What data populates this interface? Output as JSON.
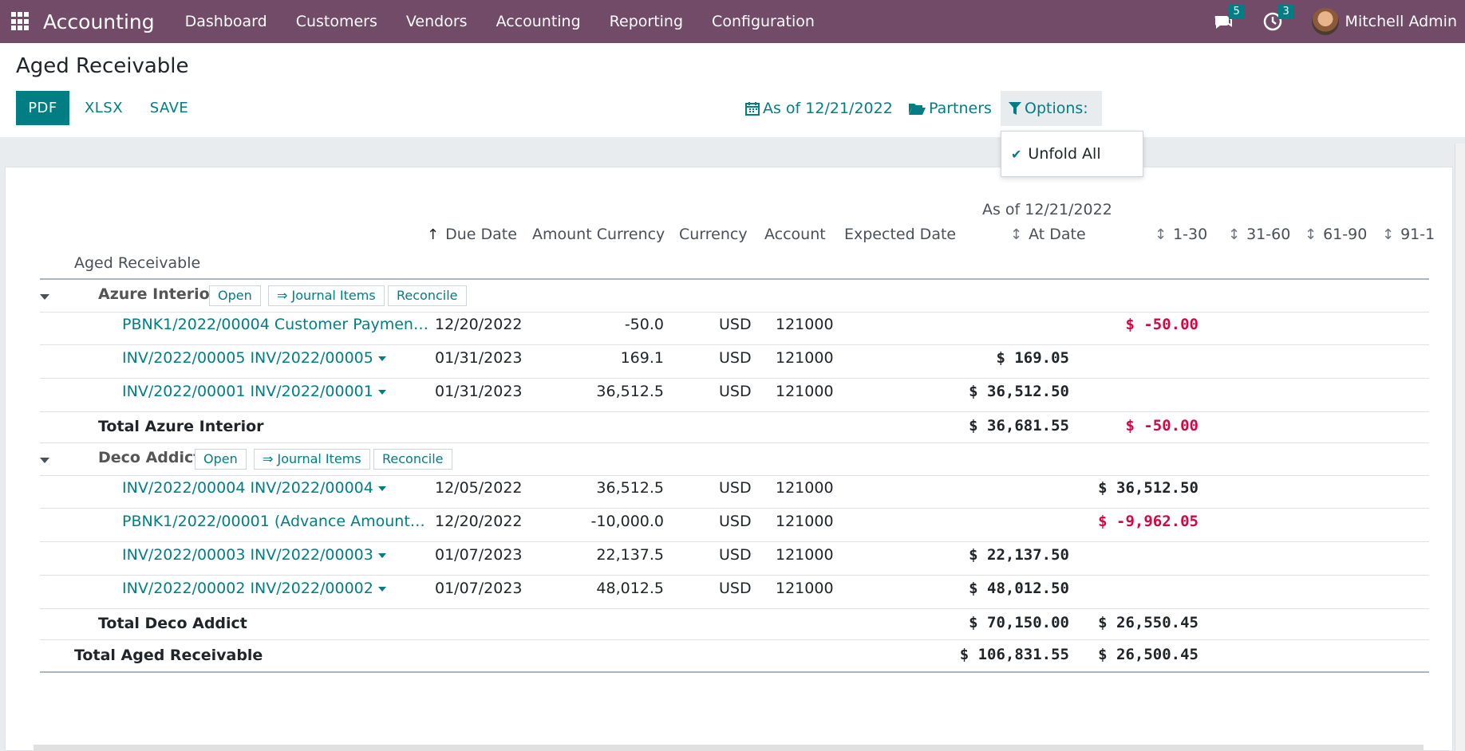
{
  "navbar": {
    "brand": "Accounting",
    "menu": [
      "Dashboard",
      "Customers",
      "Vendors",
      "Accounting",
      "Reporting",
      "Configuration"
    ],
    "messages_count": "5",
    "activities_count": "3",
    "user_name": "Mitchell Admin"
  },
  "control": {
    "title": "Aged Receivable",
    "pdf_label": "PDF",
    "xlsx_label": "XLSX",
    "save_label": "SAVE",
    "date_filter": "As of 12/21/2022",
    "partners_filter": "Partners",
    "options_filter": "Options:",
    "dropdown_item": "Unfold All"
  },
  "report": {
    "as_of": "As of 12/21/2022",
    "columns": {
      "name": "Aged Receivable",
      "due_date": "Due Date",
      "amount_currency": "Amount Currency",
      "currency": "Currency",
      "account": "Account",
      "expected_date": "Expected Date",
      "at_date": "At Date",
      "c1_30": "1-30",
      "c31_60": "31-60",
      "c61_90": "61-90",
      "c91": "91-1"
    },
    "actions": {
      "open": "Open",
      "journal": "⇒ Journal Items",
      "reconcile": "Reconcile"
    },
    "partners": [
      {
        "name": "Azure Interior",
        "lines": [
          {
            "ref": "PBNK1/2022/00004 Customer Paymen…",
            "due": "12/20/2022",
            "amount": "-50.0",
            "currency": "USD",
            "account": "121000",
            "at_date": "",
            "d1_30": "$ -50.00"
          },
          {
            "ref": "INV/2022/00005 INV/2022/00005",
            "due": "01/31/2023",
            "amount": "169.1",
            "currency": "USD",
            "account": "121000",
            "at_date": "$ 169.05",
            "d1_30": ""
          },
          {
            "ref": "INV/2022/00001 INV/2022/00001",
            "due": "01/31/2023",
            "amount": "36,512.5",
            "currency": "USD",
            "account": "121000",
            "at_date": "$ 36,512.50",
            "d1_30": ""
          }
        ],
        "total_label": "Total Azure Interior",
        "total_at_date": "$ 36,681.55",
        "total_1_30": "$ -50.00"
      },
      {
        "name": "Deco Addict",
        "lines": [
          {
            "ref": "INV/2022/00004 INV/2022/00004",
            "due": "12/05/2022",
            "amount": "36,512.5",
            "currency": "USD",
            "account": "121000",
            "at_date": "",
            "d1_30": "$ 36,512.50"
          },
          {
            "ref": "PBNK1/2022/00001 (Advance Amount…",
            "due": "12/20/2022",
            "amount": "-10,000.0",
            "currency": "USD",
            "account": "121000",
            "at_date": "",
            "d1_30": "$ -9,962.05"
          },
          {
            "ref": "INV/2022/00003 INV/2022/00003",
            "due": "01/07/2023",
            "amount": "22,137.5",
            "currency": "USD",
            "account": "121000",
            "at_date": "$ 22,137.50",
            "d1_30": ""
          },
          {
            "ref": "INV/2022/00002 INV/2022/00002",
            "due": "01/07/2023",
            "amount": "48,012.5",
            "currency": "USD",
            "account": "121000",
            "at_date": "$ 48,012.50",
            "d1_30": ""
          }
        ],
        "total_label": "Total Deco Addict",
        "total_at_date": "$ 70,150.00",
        "total_1_30": "$ 26,550.45"
      }
    ],
    "grand_total_label": "Total Aged Receivable",
    "grand_total_at_date": "$ 106,831.55",
    "grand_total_1_30": "$ 26,500.45"
  },
  "colors": {
    "navbar": "#714b67",
    "accent": "#017e84",
    "negative": "#d10844"
  }
}
